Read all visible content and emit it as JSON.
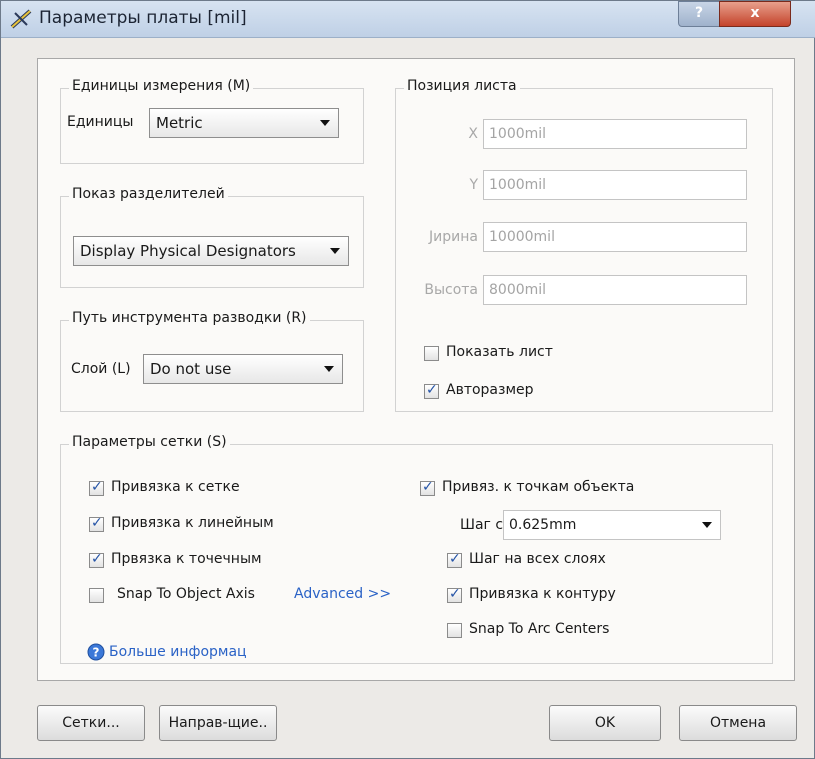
{
  "window": {
    "title": "Параметры платы [mil]",
    "help_label": "?",
    "close_label": "x"
  },
  "units_group": {
    "label": "Единицы измерения (M)",
    "field_label": "Единицы",
    "value": "Metric"
  },
  "designators_group": {
    "label": "Показ разделителей",
    "value": "Display Physical Designators"
  },
  "route_tool_group": {
    "label": "Путь инструмента разводки (R)",
    "field_label": "Слой (L)",
    "value": "Do not use"
  },
  "sheet_group": {
    "label": "Позиция листа",
    "x_label": "X",
    "x_value": "1000mil",
    "y_label": "Y",
    "y_value": "1000mil",
    "width_label": "Јирина",
    "width_value": "10000mil",
    "height_label": "Высота",
    "height_value": "8000mil",
    "show_sheet_label": "Показать лист",
    "show_sheet_checked": false,
    "autosize_label": "Авторазмер",
    "autosize_checked": true
  },
  "grid_group": {
    "label": "Параметры сетки (S)",
    "snap_grid_label": "Привязка к сетке",
    "snap_grid_checked": true,
    "snap_linear_label": "Привязка к линейным",
    "snap_linear_checked": true,
    "snap_point_label": "Првязка к точечным",
    "snap_point_checked": true,
    "snap_axis_label": "Snap To Object Axis",
    "snap_axis_checked": false,
    "advanced_label": "Advanced >>",
    "snap_hotspots_label": "Привяз. к точкам объекта",
    "snap_hotspots_checked": true,
    "snap_distance_label": "Шаг сет",
    "snap_distance_value": "0.625mm",
    "all_layers_label": "Шаг на всех слоях",
    "all_layers_checked": true,
    "board_outline_label": "Привязка к контуру",
    "board_outline_checked": true,
    "arc_centers_label": "Snap To Arc Centers",
    "arc_centers_checked": false,
    "more_info_label": "Больше информац"
  },
  "buttons": {
    "grids": "Сетки...",
    "guides": "Направ-щие..",
    "ok": "OK",
    "cancel": "Отмена"
  },
  "colors": {
    "link": "#2a62c6",
    "checkmark": "#2453a6",
    "close_button": "#c4432b"
  }
}
